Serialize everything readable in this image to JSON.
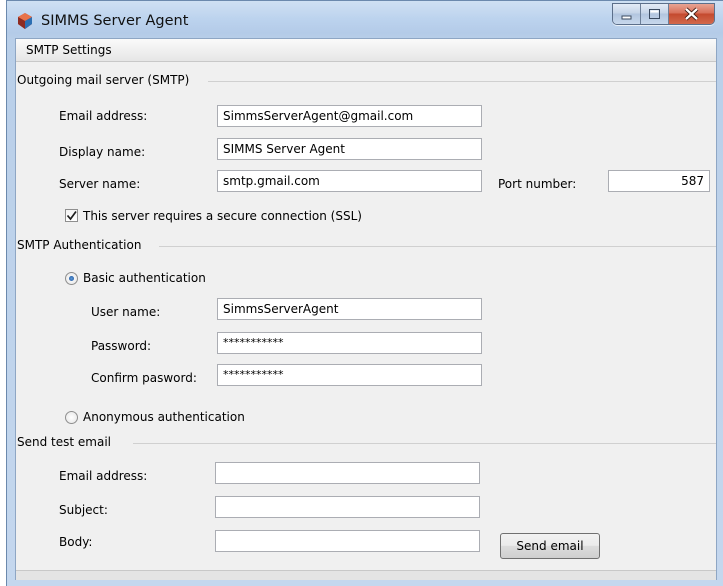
{
  "window": {
    "title": "SIMMS Server Agent",
    "minimize_icon": "minimize-icon",
    "maximize_icon": "maximize-icon",
    "close_icon": "close-icon",
    "app_icon": "app-shield-icon"
  },
  "tab": {
    "label": "SMTP Settings"
  },
  "outgoing": {
    "group_label": "Outgoing mail server (SMTP)",
    "email_label": "Email address:",
    "email_value": "SimmsServerAgent@gmail.com",
    "display_label": "Display name:",
    "display_value": "SIMMS Server Agent",
    "server_label": "Server name:",
    "server_value": "smtp.gmail.com",
    "port_label": "Port number:",
    "port_value": "587",
    "ssl_label": "This server requires a secure connection (SSL)",
    "ssl_checked": true
  },
  "auth": {
    "group_label": "SMTP Authentication",
    "basic_label": "Basic authentication",
    "basic_selected": true,
    "user_label": "User name:",
    "user_value": "SimmsServerAgent",
    "password_label": "Password:",
    "password_value": "***********",
    "confirm_label": "Confirm pasword:",
    "confirm_value": "***********",
    "anonymous_label": "Anonymous authentication",
    "anonymous_selected": false
  },
  "test": {
    "group_label": "Send test email",
    "email_label": "Email address:",
    "email_value": "",
    "subject_label": "Subject:",
    "subject_value": "",
    "body_label": "Body:",
    "body_value": "",
    "send_button": "Send email"
  }
}
